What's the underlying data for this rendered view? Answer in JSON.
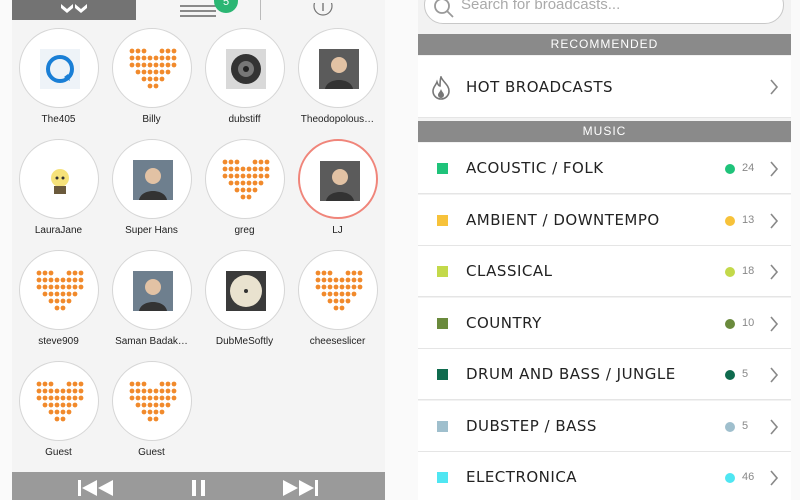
{
  "left": {
    "tabs": {
      "badge_count": "5"
    },
    "people": [
      {
        "name": "The405",
        "avatar": "the405-logo-icon"
      },
      {
        "name": "Billy",
        "avatar": "heart-dots-icon"
      },
      {
        "name": "dubstiff",
        "avatar": "speaker-photo"
      },
      {
        "name": "Theodopolous…",
        "avatar": "person-photo"
      },
      {
        "name": "LauraJane",
        "avatar": "cartoon-avatar"
      },
      {
        "name": "Super Hans",
        "avatar": "person-photo"
      },
      {
        "name": "greg",
        "avatar": "heart-dots-icon"
      },
      {
        "name": "LJ",
        "avatar": "person-photo",
        "selected": true
      },
      {
        "name": "steve909",
        "avatar": "heart-dots-icon"
      },
      {
        "name": "Saman Badak…",
        "avatar": "person-photo"
      },
      {
        "name": "DubMeSoftly",
        "avatar": "vinyl-photo"
      },
      {
        "name": "cheeseslicer",
        "avatar": "heart-dots-icon"
      },
      {
        "name": "Guest",
        "avatar": "heart-dots-icon"
      },
      {
        "name": "Guest",
        "avatar": "heart-dots-icon"
      }
    ]
  },
  "right": {
    "search": {
      "placeholder": "Search for broadcasts..."
    },
    "recommended_header": "RECOMMENDED",
    "hot_label": "HOT BROADCASTS",
    "music_header": "MUSIC",
    "genres": [
      {
        "label": "ACOUSTIC / FOLK",
        "count": "24",
        "color": "#1fc37a"
      },
      {
        "label": "AMBIENT / DOWNTEMPO",
        "count": "13",
        "color": "#f7c23a"
      },
      {
        "label": "CLASSICAL",
        "count": "18",
        "color": "#c3d94a"
      },
      {
        "label": "COUNTRY",
        "count": "10",
        "color": "#6a8a3c"
      },
      {
        "label": "DRUM AND BASS / JUNGLE",
        "count": "5",
        "color": "#0f6b4e"
      },
      {
        "label": "DUBSTEP / BASS",
        "count": "5",
        "color": "#9fbfcd"
      },
      {
        "label": "ELECTRONICA",
        "count": "46",
        "color": "#4fe6f2"
      }
    ]
  }
}
